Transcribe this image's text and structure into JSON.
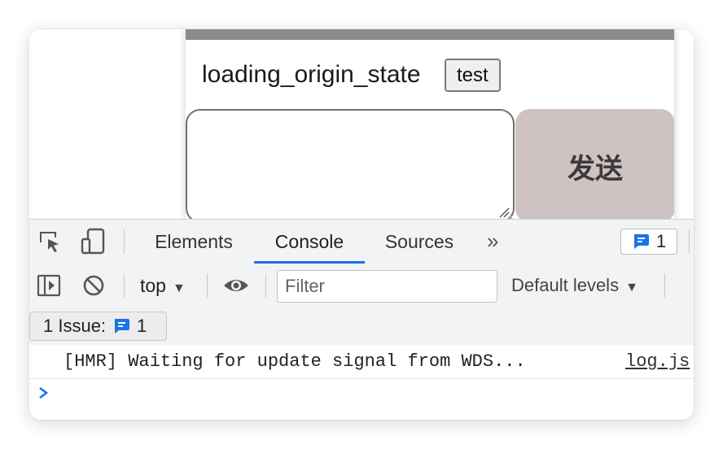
{
  "page": {
    "heading": "loading_origin_state",
    "test_button": "test",
    "send_button": "发送"
  },
  "devtools": {
    "tabs": [
      {
        "label": "Elements"
      },
      {
        "label": "Console"
      },
      {
        "label": "Sources"
      }
    ],
    "more_tabs": "»",
    "issues_badge_count": "1",
    "context": "top",
    "filter_placeholder": "Filter",
    "levels": "Default levels",
    "issues_label": "1 Issue:",
    "issues_count": "1",
    "log": {
      "message": "[HMR] Waiting for update signal from WDS...",
      "source": "log.js"
    }
  },
  "colors": {
    "accent": "#1a73e8",
    "send_button_bg": "#cfc2c2"
  },
  "icons": [
    "cursor-select-icon",
    "device-toggle-icon",
    "chat-badge-icon",
    "sidebar-toggle-icon",
    "clear-console-icon",
    "eye-icon",
    "prompt-chevron-icon"
  ]
}
